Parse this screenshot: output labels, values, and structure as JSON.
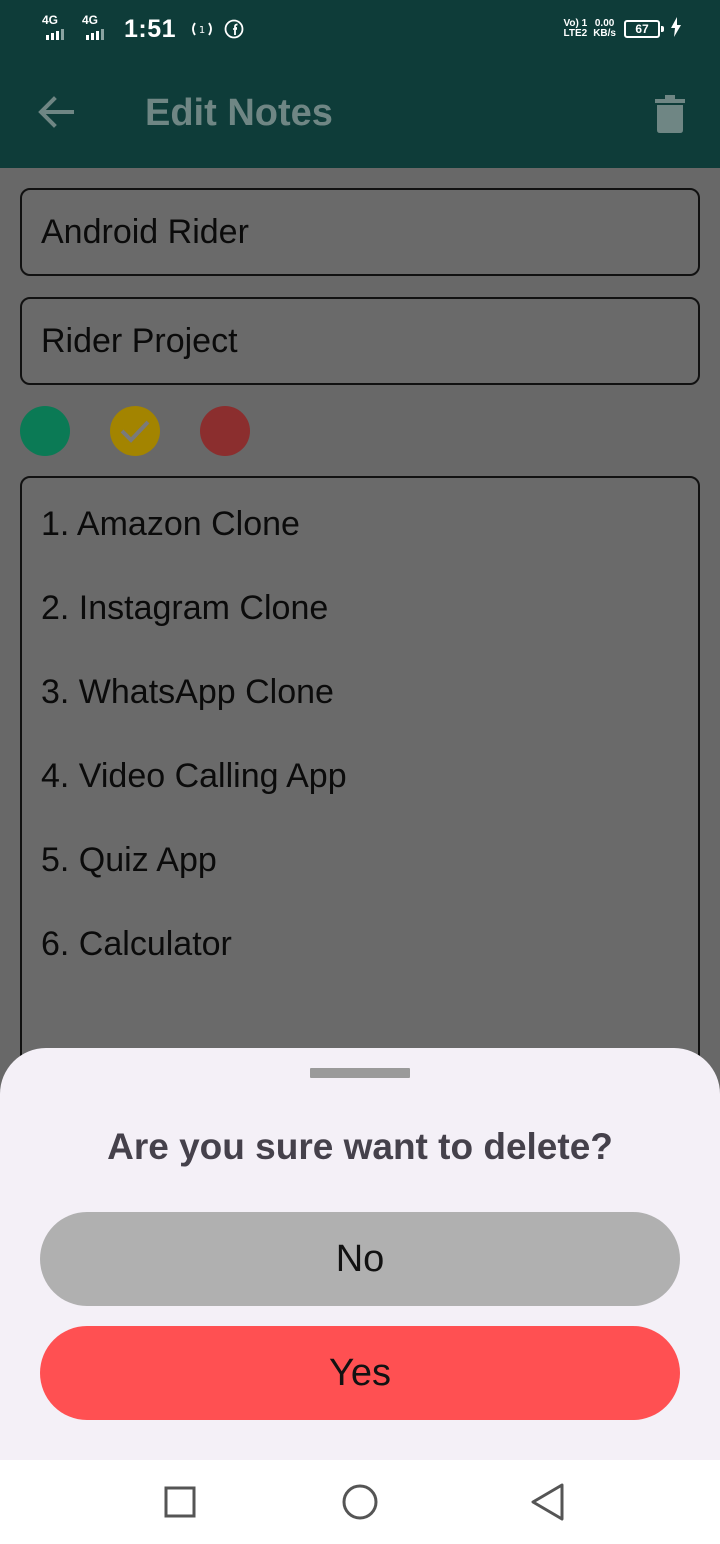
{
  "status_bar": {
    "sim1_label": "4G",
    "sim2_label": "4G",
    "time": "1:51",
    "volte_top": "Vo) 1",
    "volte_bottom": "LTE2",
    "speed_top": "0.00",
    "speed_bottom": "KB/s",
    "battery": "67",
    "icons": [
      "signal-icon",
      "signal-icon",
      "hotspot-icon",
      "facebook-icon",
      "charging-icon"
    ]
  },
  "app_bar": {
    "title": "Edit Notes",
    "back_icon": "arrow-left-icon",
    "delete_icon": "trash-icon",
    "bg_color": "#0e3c39"
  },
  "form": {
    "title_value": "Android Rider",
    "subtitle_value": "Rider Project",
    "colors": [
      {
        "name": "green",
        "hex": "#0b7a55",
        "selected": false
      },
      {
        "name": "yellow",
        "hex": "#a38400",
        "selected": true
      },
      {
        "name": "red",
        "hex": "#8b2e2e",
        "selected": false
      }
    ],
    "note_lines": [
      "1. Amazon Clone",
      "2. Instagram Clone",
      "3. WhatsApp Clone",
      "4. Video Calling App",
      "5. Quiz App",
      "6. Calculator"
    ]
  },
  "sheet": {
    "title": "Are you sure want to delete?",
    "no_label": "No",
    "yes_label": "Yes",
    "yes_color": "#ff5052",
    "no_color": "#b0b0b0"
  },
  "nav": {
    "icons": [
      "recents-square-icon",
      "home-circle-icon",
      "back-triangle-icon"
    ]
  }
}
